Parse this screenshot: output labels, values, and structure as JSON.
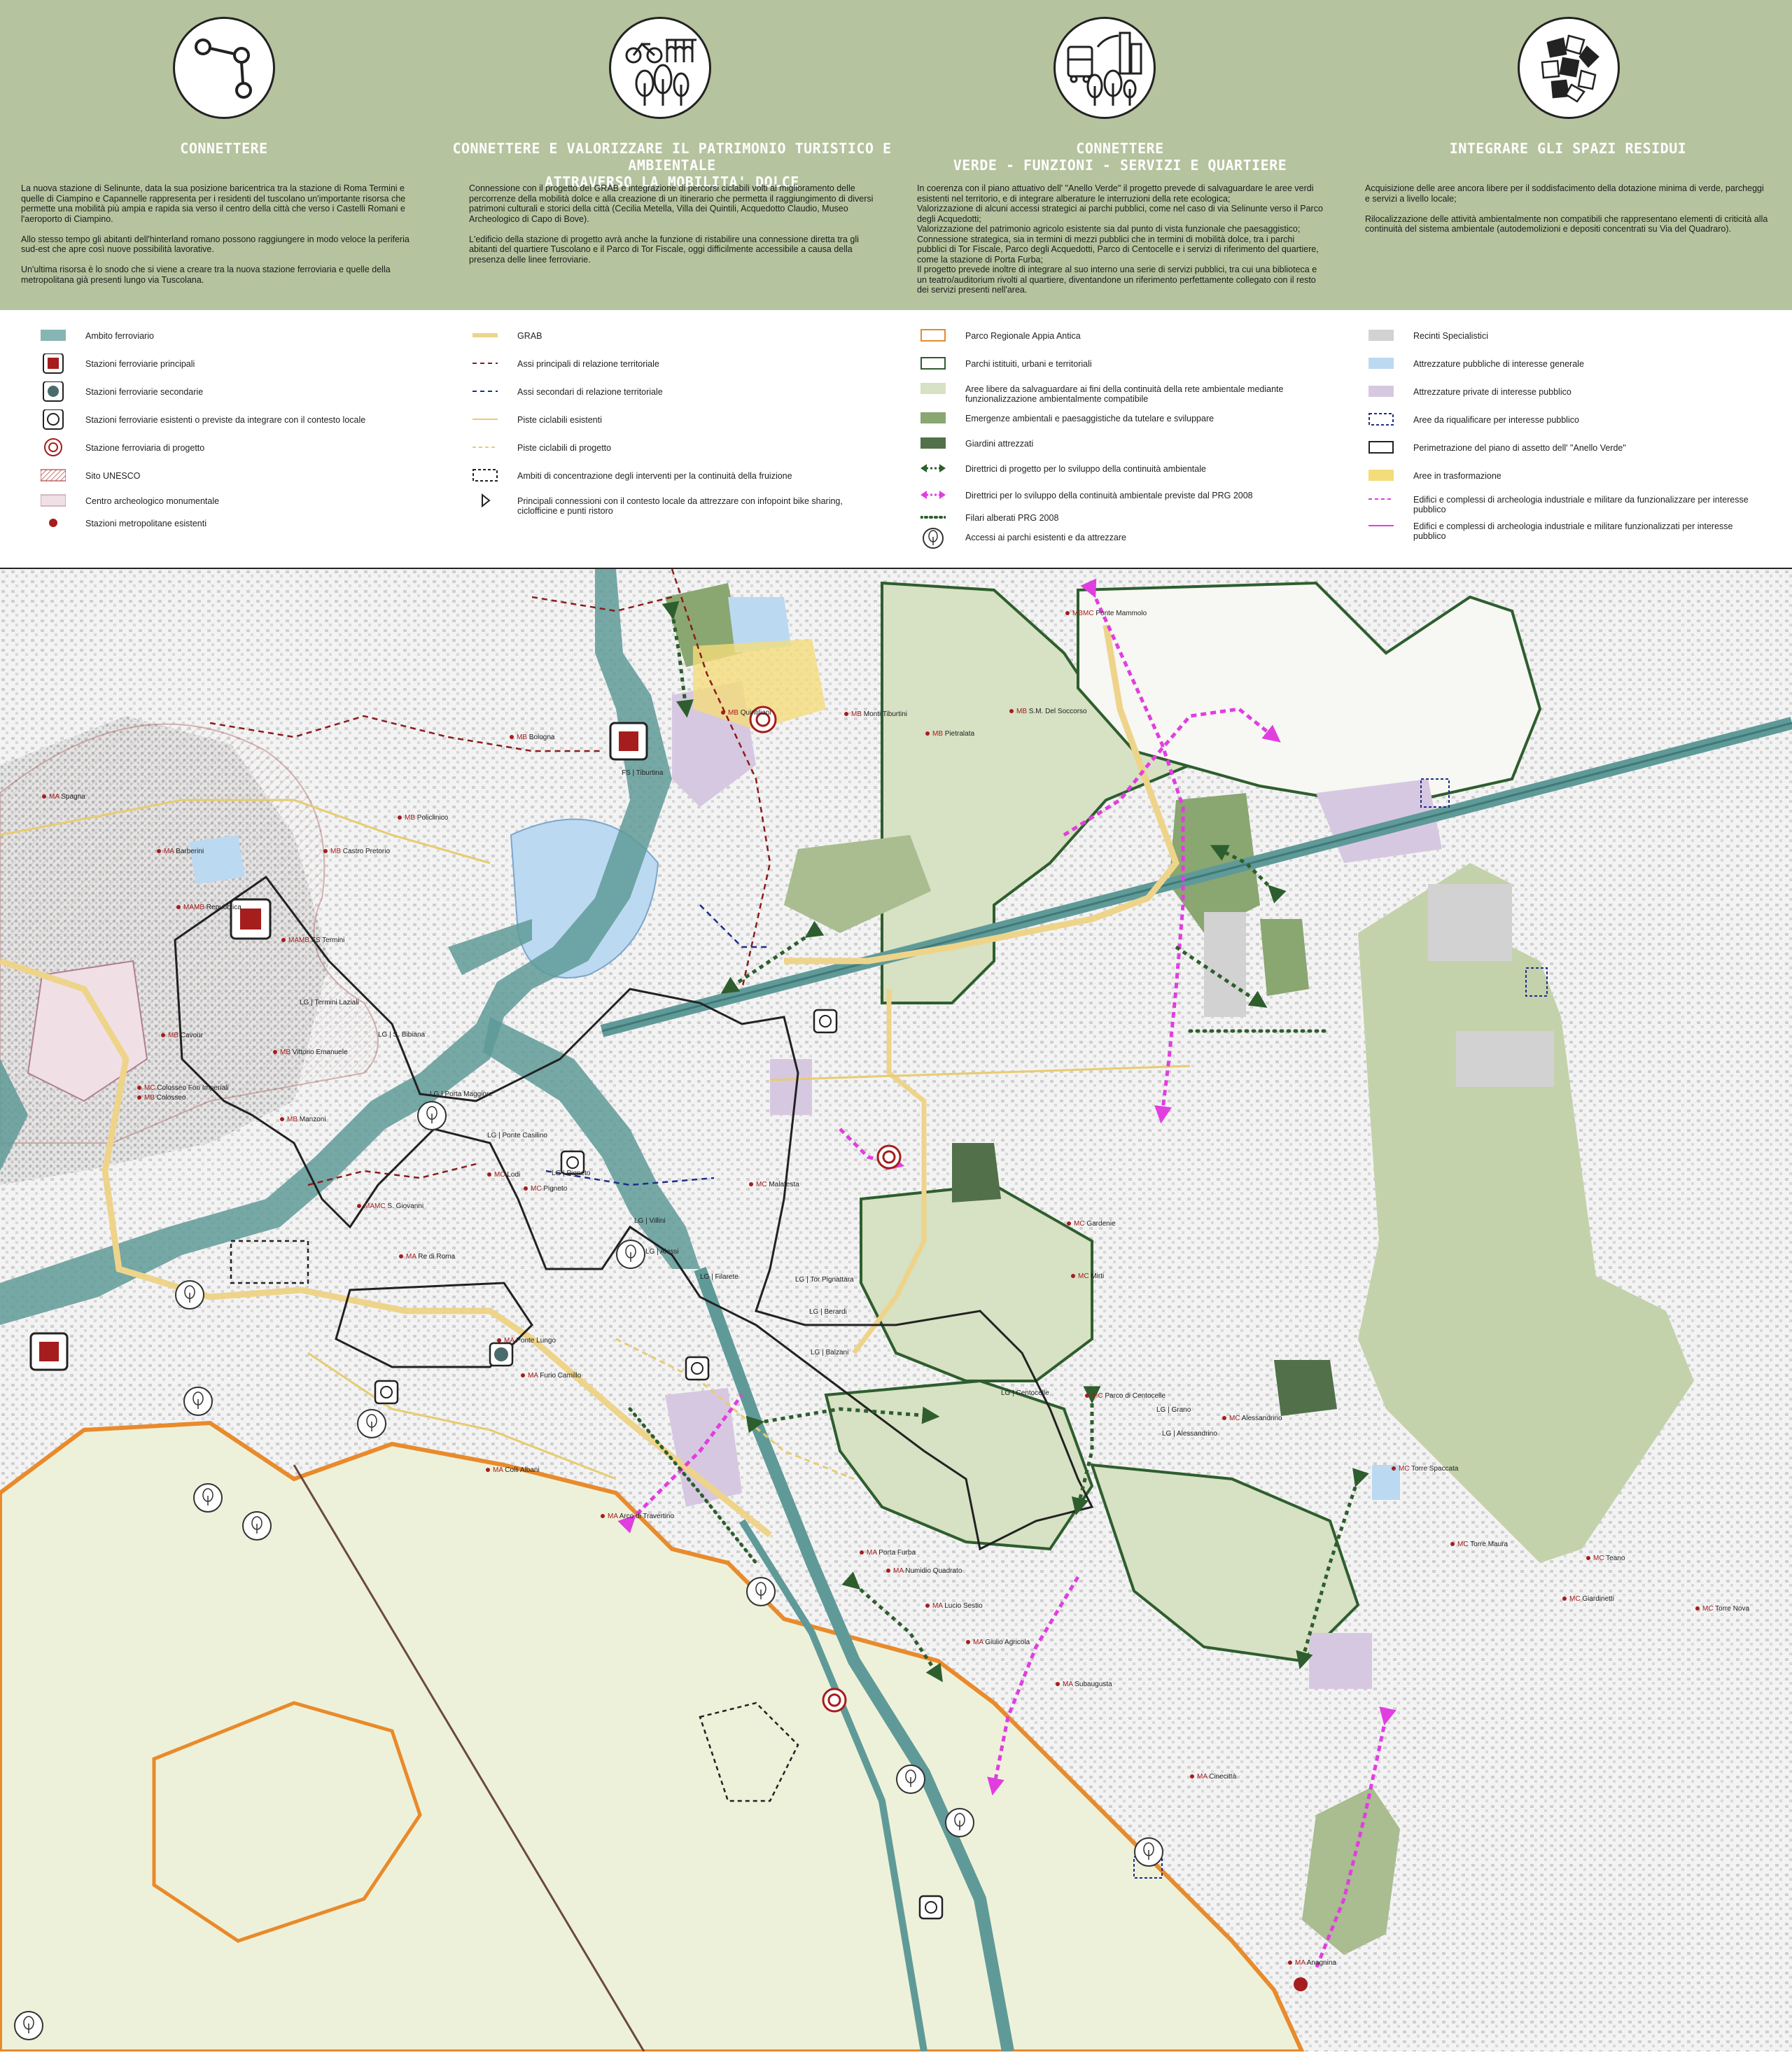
{
  "header": {
    "columns": [
      {
        "title": "CONNETTERE",
        "icon": "network-nodes-icon",
        "text": "La nuova stazione di Selinunte, data la sua posizione baricentrica tra la stazione di Roma Termini e quelle di Ciampino e Capannelle rappresenta per i residenti del tuscolano un'importante risorsa che permette una mobilità più ampia e rapida sia verso il centro della città che verso i Castelli Romani e l'aeroporto di Ciampino.\n\nAllo stesso tempo gli abitanti dell'hinterland romano possono raggiungere in modo veloce la periferia sud-est che apre così nuove possibilità lavorative.\n\nUn'ultima risorsa è lo snodo che si viene a creare tra la nuova stazione ferroviaria e quelle della metropolitana già presenti lungo via Tuscolana."
      },
      {
        "title": "CONNETTERE E VALORIZZARE IL PATRIMONIO TURISTICO E AMBIENTALE\nATTRAVERSO LA MOBILITA' DOLCE",
        "icon": "bicycle-aqueduct-icon",
        "text": "Connessione con il progetto del GRAB e integrazione di percorsi ciclabili volti al miglioramento delle percorrenze della mobilità dolce e alla creazione di un itinerario che permetta il raggiungimento di diversi patrimoni culturali e storici della città (Cecilia Metella, Villa dei Quintili, Acquedotto Claudio, Museo Archeologico di Capo di Bove).\n\nL'edificio della stazione di progetto avrà anche la funzione di ristabilire una connessione diretta tra gli abitanti del quartiere Tuscolano e il Parco di Tor Fiscale, oggi difficilmente accessibile a causa della presenza delle linee ferroviarie."
      },
      {
        "title": "CONNETTERE\nVERDE - FUNZIONI - SERVIZI E QUARTIERE",
        "icon": "bus-trees-city-icon",
        "text": "In coerenza con il piano attuativo dell' \"Anello Verde\" il progetto prevede di salvaguardare le aree verdi esistenti nel territorio, e di integrare alberature le interruzioni della rete ecologica;\nValorizzazione di alcuni accessi strategici ai parchi pubblici, come nel caso di via Selinunte verso il Parco degli Acquedotti;\nValorizzazione del patrimonio agricolo esistente sia dal punto di vista funzionale che paesaggistico;\nConnessione strategica, sia in termini di mezzi pubblici che in termini di mobilità dolce, tra i parchi pubblici di Tor Fiscale, Parco degli Acquedotti, Parco di Centocelle e i servizi di riferimento del quartiere, come la stazione di Porta Furba;\nIl progetto prevede inoltre di integrare al suo interno una serie di servizi pubblici, tra cui una biblioteca e un teatro/auditorium rivolti al quartiere, diventandone un riferimento perfettamente collegato con il resto dei servizi presenti nell'area."
      },
      {
        "title": "INTEGRARE GLI SPAZI RESIDUI",
        "icon": "fragments-icon",
        "text": "Acquisizione delle aree ancora libere per il soddisfacimento della dotazione minima di verde, parcheggi e servizi a livello locale;\n\nRilocalizzazione delle attività ambientalmente non compatibili che rappresentano elementi di criticità alla continuità del sistema ambientale (autodemolizioni e depositi concentrati su Via del Quadraro)."
      }
    ]
  },
  "legend": {
    "col1": [
      {
        "symbol": "fill-teal",
        "label": "Ambito ferroviario"
      },
      {
        "symbol": "station-main",
        "label": "Stazioni ferroviarie principali"
      },
      {
        "symbol": "station-secondary",
        "label": "Stazioni ferroviarie secondarie"
      },
      {
        "symbol": "station-existing",
        "label": "Stazioni ferroviarie esistenti o previste da integrare con il contesto locale"
      },
      {
        "symbol": "station-project",
        "label": "Stazione ferroviaria di progetto"
      },
      {
        "symbol": "fill-unesco",
        "label": "Sito UNESCO"
      },
      {
        "symbol": "fill-archeo",
        "label": "Centro archeologico monumentale"
      },
      {
        "symbol": "dot-metro",
        "label": "Stazioni metropolitane esistenti"
      }
    ],
    "col2": [
      {
        "symbol": "line-grab",
        "label": "GRAB"
      },
      {
        "symbol": "dash-red",
        "label": "Assi principali di relazione territoriale"
      },
      {
        "symbol": "dash-blue",
        "label": "Assi secondari di relazione territoriale"
      },
      {
        "symbol": "line-bike",
        "label": "Piste ciclabili esistenti"
      },
      {
        "symbol": "dash-bike",
        "label": "Piste ciclabili di progetto"
      },
      {
        "symbol": "box-dashed",
        "label": "Ambiti di concentrazione degli interventi per la continuità della fruizione"
      },
      {
        "symbol": "triangle",
        "label": "Principali connessioni con il contesto locale da attrezzare con infopoint bike sharing, ciclofficine e punti ristoro"
      }
    ],
    "col3": [
      {
        "symbol": "outline-orange",
        "label": "Parco Regionale Appia Antica"
      },
      {
        "symbol": "outline-green",
        "label": "Parchi istituiti, urbani e territoriali"
      },
      {
        "symbol": "fill-lightgreen",
        "label": "Aree libere da salvaguardare ai fini della continuità della rete ambientale mediante funzionalizzazione ambientalmente compatibile"
      },
      {
        "symbol": "fill-midgreen",
        "label": "Emergenze ambientali e paesaggistiche da tutelare e sviluppare"
      },
      {
        "symbol": "fill-darkgreen",
        "label": "Giardini attrezzati"
      },
      {
        "symbol": "arrow-green",
        "label": "Direttrici di progetto per lo sviluppo della continuità ambientale"
      },
      {
        "symbol": "arrow-magenta",
        "label": "Direttrici per lo sviluppo della continuità ambientale previste dal PRG 2008"
      },
      {
        "symbol": "dots-green",
        "label": "Filari alberati PRG 2008"
      },
      {
        "symbol": "tree-circle",
        "label": "Accessi ai parchi esistenti e da attrezzare"
      }
    ],
    "col4": [
      {
        "symbol": "fill-grey",
        "label": "Recinti Specialistici"
      },
      {
        "symbol": "fill-lightblue",
        "label": "Attrezzature pubbliche di interesse generale"
      },
      {
        "symbol": "fill-lilac",
        "label": "Attrezzature private di interesse pubblico"
      },
      {
        "symbol": "box-blue-dashed",
        "label": "Aree da riqualificare per interesse pubblico"
      },
      {
        "symbol": "box-black",
        "label": "Perimetrazione del piano di assetto dell' \"Anello Verde\""
      },
      {
        "symbol": "fill-yellow",
        "label": "Aree in trasformazione"
      },
      {
        "symbol": "dash-magenta",
        "label": "Edifici e complessi di archeologia industriale e militare da funzionalizzare per interesse pubblico"
      },
      {
        "symbol": "line-magenta",
        "label": "Edifici e complessi di archeologia industriale e militare funzionalizzati per interesse pubblico"
      }
    ]
  },
  "map": {
    "stations": [
      {
        "code": "MB",
        "name": "Bologna"
      },
      {
        "code": "MA",
        "name": "Spagna"
      },
      {
        "code": "MA",
        "name": "Barberini"
      },
      {
        "code": "MB",
        "name": "Policlinico"
      },
      {
        "code": "MB",
        "name": "Castro Pretorio"
      },
      {
        "code": "MAMB",
        "name": "Repubblica"
      },
      {
        "code": "MAMB",
        "name": "FS Termini"
      },
      {
        "code": "MB",
        "name": "Cavour"
      },
      {
        "code": "MB",
        "name": "Vittorio Emanuele"
      },
      {
        "code": "MB",
        "name": "Manzoni"
      },
      {
        "code": "MC",
        "name": "Colosseo Fori Imperiali"
      },
      {
        "code": "MB",
        "name": "Colosseo"
      },
      {
        "code": "MAMC",
        "name": "S. Giovanni"
      },
      {
        "code": "MA",
        "name": "Re di Roma"
      },
      {
        "code": "MA",
        "name": "Ponte Lungo"
      },
      {
        "code": "MA",
        "name": "Furio Camillo"
      },
      {
        "code": "MA",
        "name": "Colli Albani"
      },
      {
        "code": "MA",
        "name": "Arco di Travertino"
      },
      {
        "code": "MA",
        "name": "Porta Furba"
      },
      {
        "code": "MA",
        "name": "Numidio Quadrato"
      },
      {
        "code": "MA",
        "name": "Lucio Sestio"
      },
      {
        "code": "MA",
        "name": "Giulio Agricola"
      },
      {
        "code": "MA",
        "name": "Subaugusta"
      },
      {
        "code": "MA",
        "name": "Cinecittà"
      },
      {
        "code": "MA",
        "name": "Anagnina"
      },
      {
        "code": "MB",
        "name": "Quintiliani"
      },
      {
        "code": "MB",
        "name": "Monti Tiburtini"
      },
      {
        "code": "MB",
        "name": "S.M. Del Soccorso"
      },
      {
        "code": "MB",
        "name": "Pietralata"
      },
      {
        "code": "MBMC",
        "name": "Ponte Mammolo"
      },
      {
        "code": "MC",
        "name": "Malatesta"
      },
      {
        "code": "MC",
        "name": "Lodi"
      },
      {
        "code": "MC",
        "name": "Pigneto"
      },
      {
        "code": "MC",
        "name": "Gardenie"
      },
      {
        "code": "MC",
        "name": "Mirti"
      },
      {
        "code": "MC",
        "name": "Parco di Centocelle"
      },
      {
        "code": "MC",
        "name": "Alessandrino"
      },
      {
        "code": "MC",
        "name": "Torre Spaccata"
      },
      {
        "code": "MC",
        "name": "Torre Maura"
      },
      {
        "code": "MC",
        "name": "Giardinetti"
      },
      {
        "code": "MC",
        "name": "Torre Nova"
      },
      {
        "code": "MC",
        "name": "Teano"
      }
    ],
    "rail_stops": [
      {
        "code": "FS",
        "name": "Tiburtina"
      },
      {
        "code": "LG",
        "name": "Termini Laziali"
      },
      {
        "code": "LG",
        "name": "S. Bibiana"
      },
      {
        "code": "LG",
        "name": "Porta Maggiore"
      },
      {
        "code": "LG",
        "name": "Ponte Casilino"
      },
      {
        "code": "LG",
        "name": "Pigneto"
      },
      {
        "code": "LG",
        "name": "Villini"
      },
      {
        "code": "LG",
        "name": "Alessi"
      },
      {
        "code": "LG",
        "name": "Filarete"
      },
      {
        "code": "LG",
        "name": "Berardi"
      },
      {
        "code": "LG",
        "name": "Balzani"
      },
      {
        "code": "LG",
        "name": "Tor Pignattara"
      },
      {
        "code": "LG",
        "name": "Centocelle"
      },
      {
        "code": "LG",
        "name": "Grano"
      },
      {
        "code": "LG",
        "name": "Alessandrino"
      }
    ]
  },
  "colors": {
    "header_bg": "#b5c39e",
    "railway": "#5f9a98",
    "station_red": "#a51d1d",
    "park_green": "#2e5e2e",
    "light_green": "#d7e1c3",
    "mid_green": "#8aa671",
    "dark_green": "#52704a",
    "appia_orange": "#e98a2b",
    "grab_yellow": "#eed48a",
    "magenta": "#e13ee0",
    "light_blue": "#bcd9f2",
    "lilac": "#d7c8e1",
    "grey": "#d2d2d2",
    "yellow": "#f4dc7b"
  }
}
